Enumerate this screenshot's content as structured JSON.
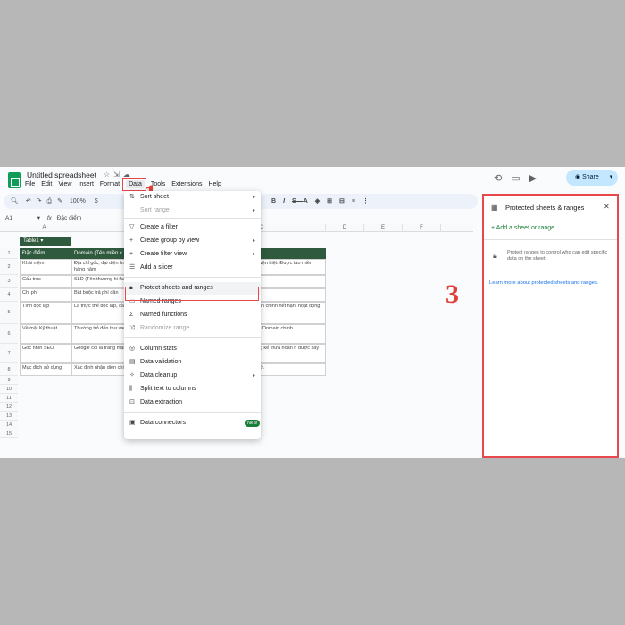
{
  "window": {
    "doc_title": "Untitled spreadsheet"
  },
  "menubar": [
    "File",
    "Edit",
    "View",
    "Insert",
    "Format",
    "Data",
    "Tools",
    "Extensions",
    "Help"
  ],
  "menubar_active": "Data",
  "share_label": "Share",
  "toolbar": {
    "zoom": "100%",
    "currency": "$"
  },
  "namebox": {
    "ref": "A1",
    "formula": "Đặc điểm"
  },
  "columns": [
    "A",
    "B",
    "C",
    "D",
    "E",
    "F"
  ],
  "rows": [
    "1",
    "2",
    "3",
    "4",
    "5",
    "6",
    "7",
    "8",
    "9",
    "10",
    "11",
    "12",
    "13",
    "14",
    "15"
  ],
  "table": {
    "name": "Table1",
    "headers": [
      "Đặc điểm",
      "Domain (Tên miền c",
      "phụ)"
    ],
    "rows": [
      [
        "Khái niệm",
        "Địa chỉ gốc, đại diện Internet. Là thực thể phí duy trì hàng năm",
        "main chính, tạo ra các khu vện biệt. Được tạo miền"
      ],
      [
        "Cấu trúc",
        "SLD (Tên thương hi facebook.com",
        "main. Ví dụ:"
      ],
      [
        "Chi phí",
        "Bắt buộc trả phí đăn",
        "hạn số lượng (tùy thuộc"
      ],
      [
        "Tính độc lập",
        "Là thực thể độc lập, cần miền nào khác.",
        "hụ thuộc hoàn toàn vào main chính hết hạn, hoạt động."
      ],
      [
        "Về mặt Kỹ thuật",
        "Thường trỏ đến thư website chính.",
        "riêng hoặc thậm chỉ là o với Domain chính."
      ],
      [
        "Góc nhìn SEO",
        "Google coi là trang mạnh\" và uy tín (Do",
        "n là website độc lập. ự động kế thừa hoàn n được xây dựng riêng."
      ],
      [
        "Mục đích sử dụng",
        "Xác định nhận diện chính thức.",
        "(Blog, Shop) hoặc các n ngữ."
      ]
    ]
  },
  "data_menu": {
    "items": [
      {
        "label": "Sort sheet",
        "icon": "sort-icon",
        "submenu": true
      },
      {
        "label": "Sort range",
        "icon": "",
        "submenu": true,
        "disabled": true
      },
      {
        "label": "Create a filter",
        "icon": "filter-icon"
      },
      {
        "label": "Create group by view",
        "icon": "plus-icon",
        "submenu": true
      },
      {
        "label": "Create filter view",
        "icon": "plus-icon",
        "submenu": true
      },
      {
        "label": "Add a slicer",
        "icon": "slicer-icon"
      },
      {
        "label": "Protect sheets and ranges",
        "icon": "lock-icon"
      },
      {
        "label": "Named ranges",
        "icon": "named-ranges-icon"
      },
      {
        "label": "Named functions",
        "icon": "sigma-icon"
      },
      {
        "label": "Randomize range",
        "icon": "shuffle-icon",
        "disabled": true
      },
      {
        "label": "Column stats",
        "icon": "lightbulb-icon"
      },
      {
        "label": "Data validation",
        "icon": "validation-icon"
      },
      {
        "label": "Data cleanup",
        "icon": "cleanup-icon",
        "submenu": true
      },
      {
        "label": "Split text to columns",
        "icon": "split-icon"
      },
      {
        "label": "Data extraction",
        "icon": "extraction-icon"
      },
      {
        "label": "Data connectors",
        "icon": "database-icon",
        "badge": "New",
        "submenu": true
      }
    ]
  },
  "panel": {
    "title": "Protected sheets & ranges",
    "add_label": "+ Add a sheet or range",
    "description": "Protect ranges to control who can edit specific data on the sheet.",
    "learn_more": "Learn more about protected sheets and ranges."
  },
  "annotations": [
    "1",
    "2",
    "3"
  ],
  "colors": {
    "accent_red": "#e8474b",
    "table_header": "#2f5a3e",
    "share_bg": "#c2e7ff",
    "link_blue": "#1a73e8",
    "green": "#188038"
  }
}
